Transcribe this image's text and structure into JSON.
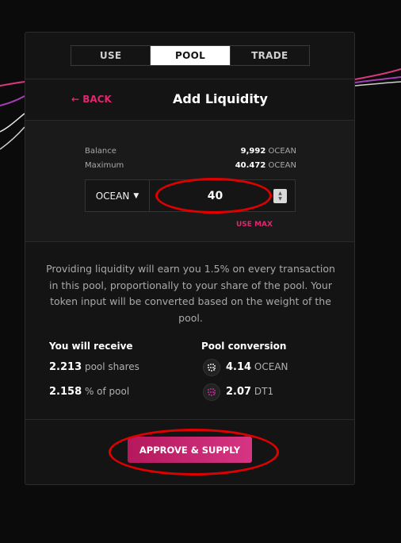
{
  "tabs": [
    {
      "label": "USE",
      "active": false
    },
    {
      "label": "POOL",
      "active": true
    },
    {
      "label": "TRADE",
      "active": false
    }
  ],
  "header": {
    "back_label": "← BACK",
    "title": "Add Liquidity"
  },
  "balance": {
    "balance_label": "Balance",
    "balance_value": "9,992",
    "balance_unit": "OCEAN",
    "maximum_label": "Maximum",
    "maximum_value": "40.472",
    "maximum_unit": "OCEAN"
  },
  "input": {
    "token": "OCEAN",
    "amount": "40",
    "use_max_label": "USE MAX"
  },
  "info_text": "Providing liquidity will earn you 1.5% on every transaction in this pool, proportionally to your share of the pool. Your token input will be converted based on the weight of the pool.",
  "receive": {
    "heading": "You will receive",
    "shares_value": "2.213",
    "shares_label": "pool shares",
    "percent_value": "2.158",
    "percent_label": "% of pool"
  },
  "conversion": {
    "heading": "Pool conversion",
    "ocean_value": "4.14",
    "ocean_label": "OCEAN",
    "dt_value": "2.07",
    "dt_label": "DT1"
  },
  "action": {
    "approve_label": "APPROVE & SUPPLY"
  },
  "colors": {
    "accent": "#e0266e",
    "annotation": "#e00000",
    "panel": "#141414",
    "background": "#0b0b0b"
  },
  "icons": {
    "ocean_token": "ocean-token-icon",
    "dt_token": "datatoken-icon",
    "caret": "caret-down-icon"
  }
}
